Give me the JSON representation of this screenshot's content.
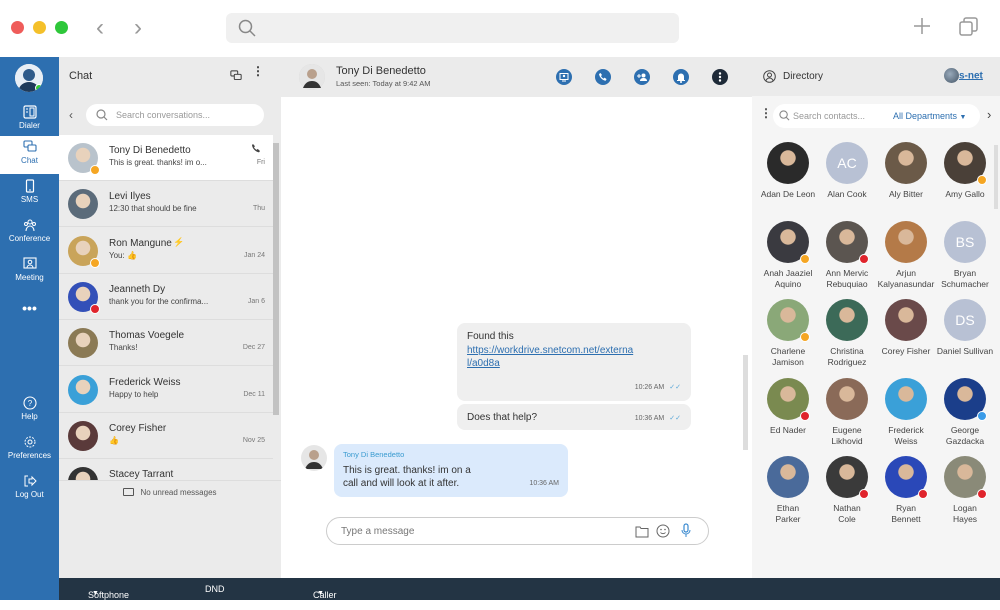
{
  "window": {
    "controls": [
      "close",
      "minimize",
      "maximize"
    ],
    "nav": {
      "back_icon": "chevron-left",
      "forward_icon": "chevron-right"
    },
    "search_icon": "magnifier",
    "new_tab_icon": "plus",
    "windows_icon": "copy"
  },
  "rail": {
    "items": [
      {
        "label": "Dialer",
        "icon": "dialpad-icon"
      },
      {
        "label": "Chat",
        "icon": "chat-icon",
        "active": true
      },
      {
        "label": "SMS",
        "icon": "phone-icon"
      },
      {
        "label": "Conference",
        "icon": "group-icon"
      },
      {
        "label": "Meeting",
        "icon": "meeting-icon"
      },
      {
        "label": "•••",
        "icon": "more-icon"
      }
    ],
    "bottom_items": [
      {
        "label": "Help",
        "icon": "help-icon"
      },
      {
        "label": "Preferences",
        "icon": "gear-icon"
      },
      {
        "label": "Log Out",
        "icon": "logout-icon"
      }
    ]
  },
  "chatlist": {
    "title": "Chat",
    "search_placeholder": "Search conversations...",
    "conversations": [
      {
        "name": "Tony Di Benedetto",
        "preview": "This is great. thanks! im o...",
        "date": "Fri",
        "status": "away",
        "active": true,
        "call_icon": true,
        "color": "#b9c3cc"
      },
      {
        "name": "Levi Ilyes",
        "preview": "12:30 that should be fine",
        "date": "Thu",
        "status": "",
        "color": "#5b6b7a"
      },
      {
        "name": "Ron Mangune",
        "preview": "You: 👍",
        "date": "Jan 24",
        "status": "away",
        "flag": "⚡",
        "color": "#c9a45a"
      },
      {
        "name": "Jeanneth Dy",
        "preview": "thank you for the confirma...",
        "date": "Jan 6",
        "status": "dnd",
        "color": "#3350b8"
      },
      {
        "name": "Thomas Voegele",
        "preview": "Thanks!",
        "date": "Dec 27",
        "status": "",
        "color": "#8b7a55"
      },
      {
        "name": "Frederick Weiss",
        "preview": "Happy to help",
        "date": "Dec 11",
        "status": "",
        "color": "#3aa0d8"
      },
      {
        "name": "Corey Fisher",
        "preview": "👍",
        "date": "Nov 25",
        "status": "",
        "color": "#5a3a3a"
      },
      {
        "name": "Stacey Tarrant",
        "preview": "",
        "date": "",
        "status": "",
        "color": "#333"
      }
    ],
    "footer": "No unread messages"
  },
  "conversation": {
    "contact_name": "Tony Di Benedetto",
    "last_seen": "Last seen: Today at 9:42 AM",
    "actions": [
      "screen-share",
      "call",
      "add-participant",
      "notifications",
      "more"
    ],
    "messages": [
      {
        "direction": "out",
        "text": "Found this",
        "link": "https://workdrive.snetcom.net/externa l/a0d8a",
        "link_line1": "https://workdrive.snetcom.net/externa",
        "link_line2": "l/a0d8a",
        "time": "10:26 AM",
        "read": true
      },
      {
        "direction": "out",
        "text": "Does that help?",
        "time": "10:36 AM",
        "read": true
      },
      {
        "direction": "in",
        "sender": "Tony Di Benedetto",
        "text_line1": "This is great. thanks! im on a",
        "text_line2": "call and will look at it after.",
        "time": "10:36 AM"
      }
    ],
    "input_placeholder": "Type a message"
  },
  "directory": {
    "title": "Directory",
    "logo_text": "s-net",
    "search_placeholder": "Search contacts...",
    "department": "All Departments",
    "contacts": [
      {
        "line1": "Adan De Leon",
        "line2": "",
        "status": "",
        "color": "#2a2a2a"
      },
      {
        "line1": "Alan Cook",
        "line2": "",
        "initials": "AC",
        "status": "",
        "color": "#b8c1d4"
      },
      {
        "line1": "Aly Bitter",
        "line2": "",
        "status": "",
        "color": "#6b5a48"
      },
      {
        "line1": "Amy Gallo",
        "line2": "",
        "status": "away",
        "color": "#4a4038"
      },
      {
        "line1": "Anah Jaaziel",
        "line2": "Aquino",
        "status": "away",
        "color": "#3a3a40"
      },
      {
        "line1": "Ann Mervic",
        "line2": "Rebuquiao",
        "status": "dnd",
        "color": "#5b5550"
      },
      {
        "line1": "Arjun",
        "line2": "Kalyanasundar",
        "status": "",
        "color": "#b47a48"
      },
      {
        "line1": "Bryan",
        "line2": "Schumacher",
        "initials": "BS",
        "status": "",
        "color": "#b8c1d4"
      },
      {
        "line1": "Charlene",
        "line2": "Jamison",
        "status": "away",
        "color": "#8aa878"
      },
      {
        "line1": "Christina",
        "line2": "Rodriguez",
        "status": "",
        "color": "#3c6a58"
      },
      {
        "line1": "Corey Fisher",
        "line2": "",
        "status": "",
        "color": "#6a4a4a"
      },
      {
        "line1": "Daniel Sullivan",
        "line2": "",
        "initials": "DS",
        "status": "",
        "color": "#b8c1d4"
      },
      {
        "line1": "Ed Nader",
        "line2": "",
        "status": "busy",
        "color": "#7a8a50"
      },
      {
        "line1": "Eugene",
        "line2": "Likhovid",
        "status": "",
        "color": "#8a6a58"
      },
      {
        "line1": "Frederick",
        "line2": "Weiss",
        "status": "",
        "color": "#3aa0d8"
      },
      {
        "line1": "George",
        "line2": "Gazdacka",
        "status": "mobile",
        "color": "#1b3e8a"
      },
      {
        "line1": "Ethan",
        "line2": "Parker",
        "status": "",
        "color": "#4a6a9a"
      },
      {
        "line1": "Nathan",
        "line2": "Cole",
        "status": "dnd",
        "color": "#3a3a3a"
      },
      {
        "line1": "Ryan",
        "line2": "Bennett",
        "status": "dnd",
        "color": "#2a48b8"
      },
      {
        "line1": "Logan",
        "line2": "Hayes",
        "status": "busy",
        "color": "#8a8a78"
      }
    ]
  },
  "bottombar": {
    "softphone": "Softphone",
    "dnd": "DND",
    "caller_id": "Caller ID"
  },
  "colors": {
    "brand": "#2d6fb0",
    "bottombar": "#233444",
    "away": "#f5a623",
    "dnd": "#e0242c",
    "link": "#2d6fb0"
  }
}
